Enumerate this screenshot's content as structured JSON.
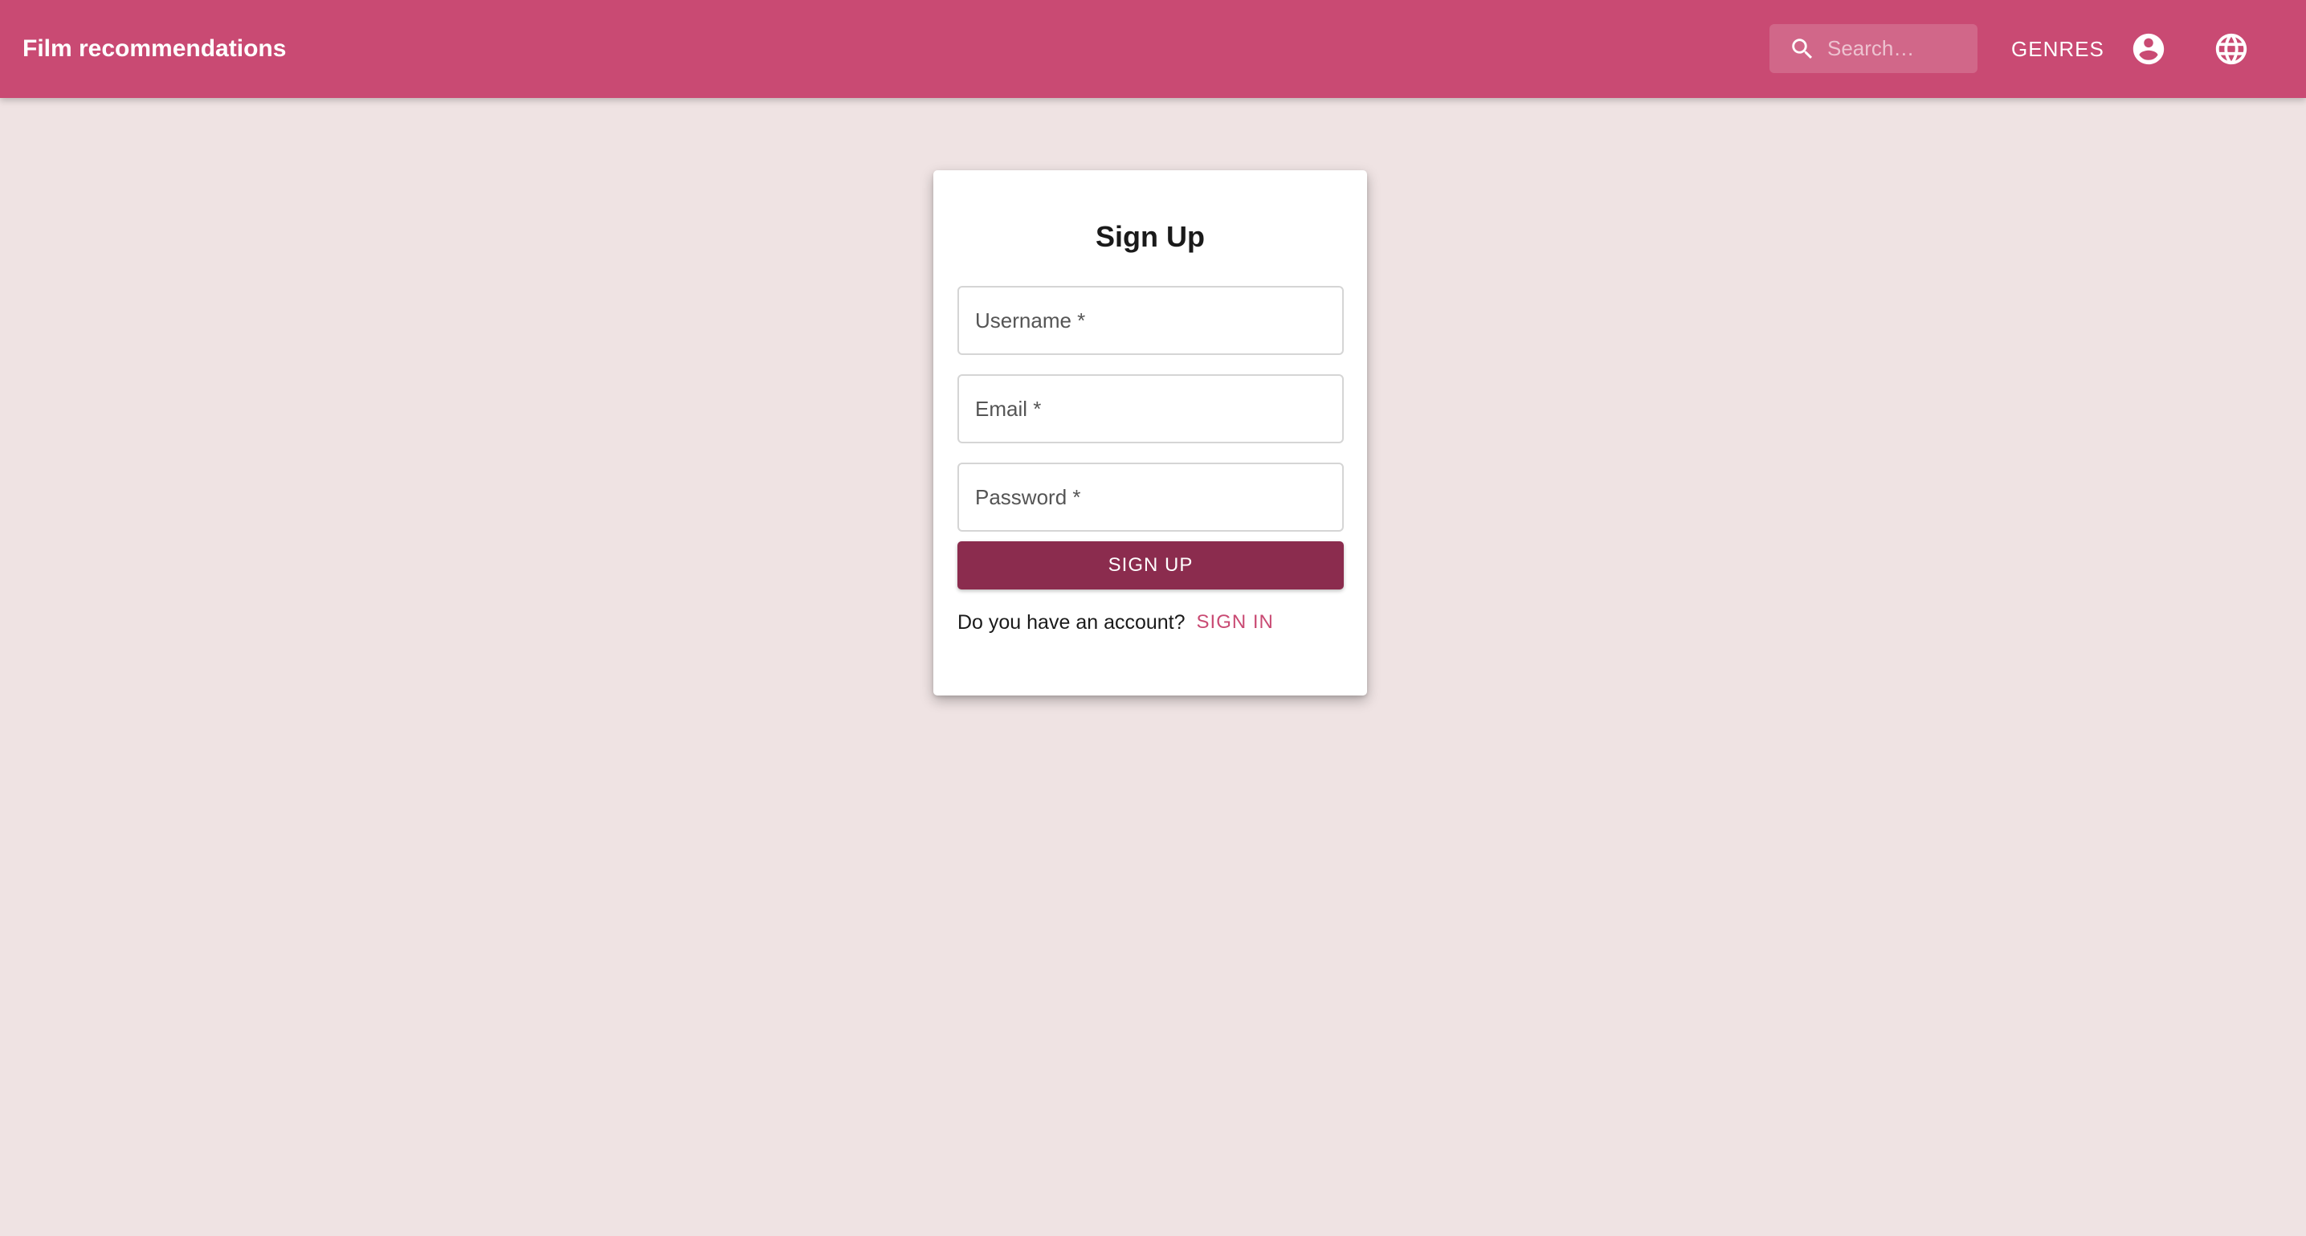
{
  "appbar": {
    "title": "Film recommendations",
    "search": {
      "placeholder": "Search…",
      "icon": "search-icon"
    },
    "genres_label": "GENRES",
    "account_icon": "account-circle-icon",
    "language_icon": "globe-icon"
  },
  "form": {
    "title": "Sign Up",
    "fields": [
      {
        "label": "Username *"
      },
      {
        "label": "Email *"
      },
      {
        "label": "Password *"
      }
    ],
    "submit_label": "SIGN UP",
    "account_question": "Do you have an account?",
    "signin_label": "SIGN IN"
  },
  "colors": {
    "appbar": "#c94a73",
    "background": "#efe3e3",
    "primary_button": "#8b2c4e",
    "link": "#c94a73"
  }
}
